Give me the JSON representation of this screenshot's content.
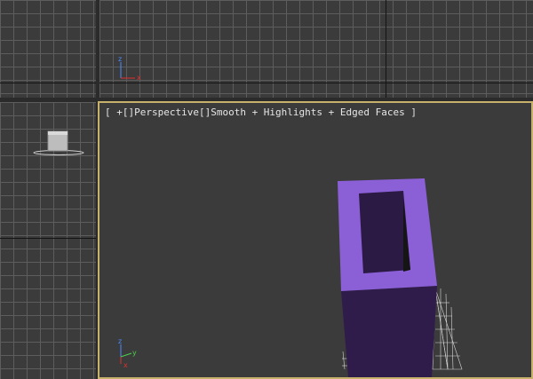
{
  "viewports": {
    "perspective": {
      "label": "[ +[]Perspective[]Smooth + Highlights + Edged Faces ]"
    }
  },
  "gizmo": {
    "x": "x",
    "y": "y",
    "z": "z"
  },
  "colors": {
    "viewport_bg": "#3b3b3b",
    "grid_line": "#5d5d5d",
    "active_border": "#c8b16a",
    "object_top": "#8b5fd6",
    "object_side": "#2f1c4b",
    "object_hole": "#2b1a44"
  },
  "icons": [
    "axis-gizmo-icon",
    "view-cube-icon"
  ]
}
